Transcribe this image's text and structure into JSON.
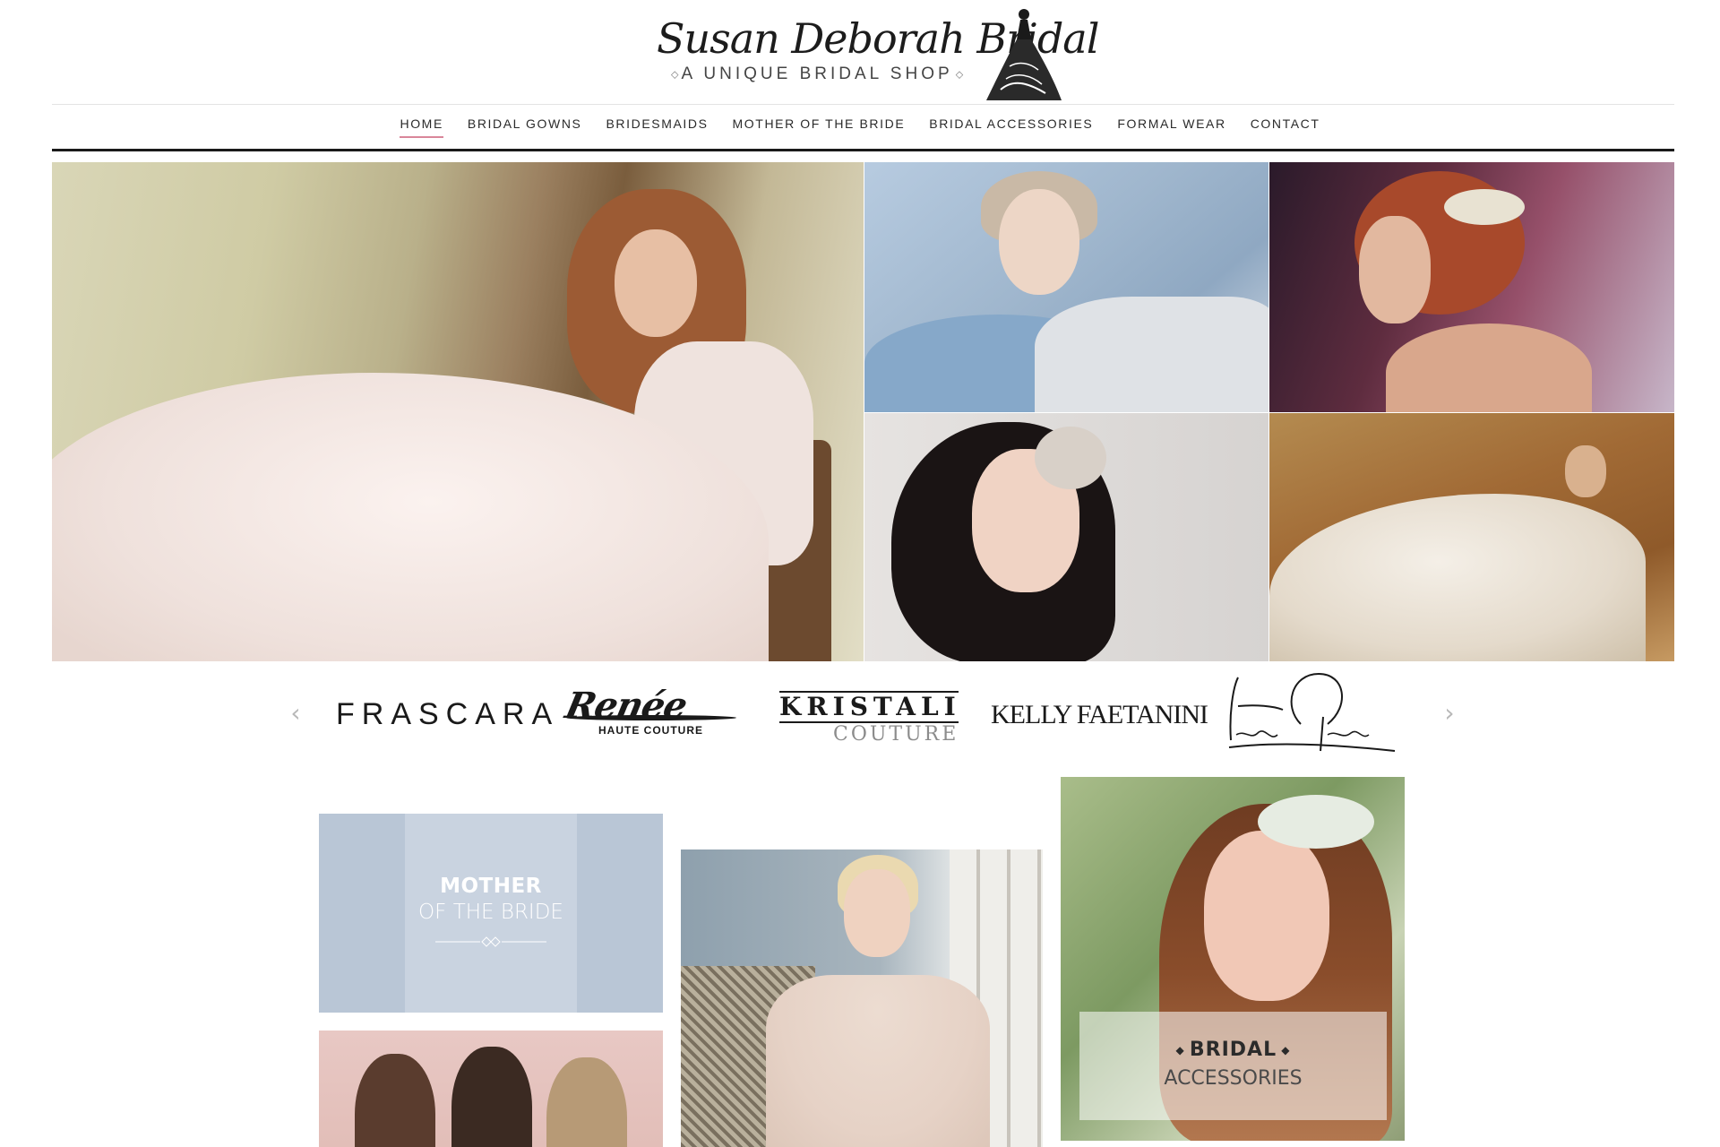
{
  "header": {
    "logo_name": "Susan Deborah Bridal",
    "logo_tagline": "A UNIQUE BRIDAL SHOP",
    "logo_icon": "bride-silhouette-icon"
  },
  "nav": {
    "items": [
      {
        "label": "HOME",
        "active": true
      },
      {
        "label": "BRIDAL GOWNS",
        "active": false
      },
      {
        "label": "BRIDESMAIDS",
        "active": false
      },
      {
        "label": "MOTHER OF THE BRIDE",
        "active": false
      },
      {
        "label": "BRIDAL ACCESSORIES",
        "active": false
      },
      {
        "label": "FORMAL WEAR",
        "active": false
      },
      {
        "label": "CONTACT",
        "active": false
      }
    ],
    "active_underline_color": "#d9869a"
  },
  "brands": {
    "prev_icon": "chevron-left-icon",
    "next_icon": "chevron-right-icon",
    "frascara": "FRASCARA",
    "renee": "Renée",
    "renee_sub": "HAUTE COUTURE",
    "kristali": "KRISTALI",
    "kristali_sub": "COUTURE",
    "kelly": "KELLY FAETANINI",
    "hayley": "Hayley Paige"
  },
  "tiles": {
    "mother_line1": "MOTHER",
    "mother_line2": "OF THE BRIDE",
    "accessories_line1": "BRIDAL",
    "accessories_line2": "ACCESSORIES"
  },
  "colors": {
    "mother_tile": "#b9c6d6",
    "accent": "#d9869a",
    "text": "#2a2a2a"
  }
}
